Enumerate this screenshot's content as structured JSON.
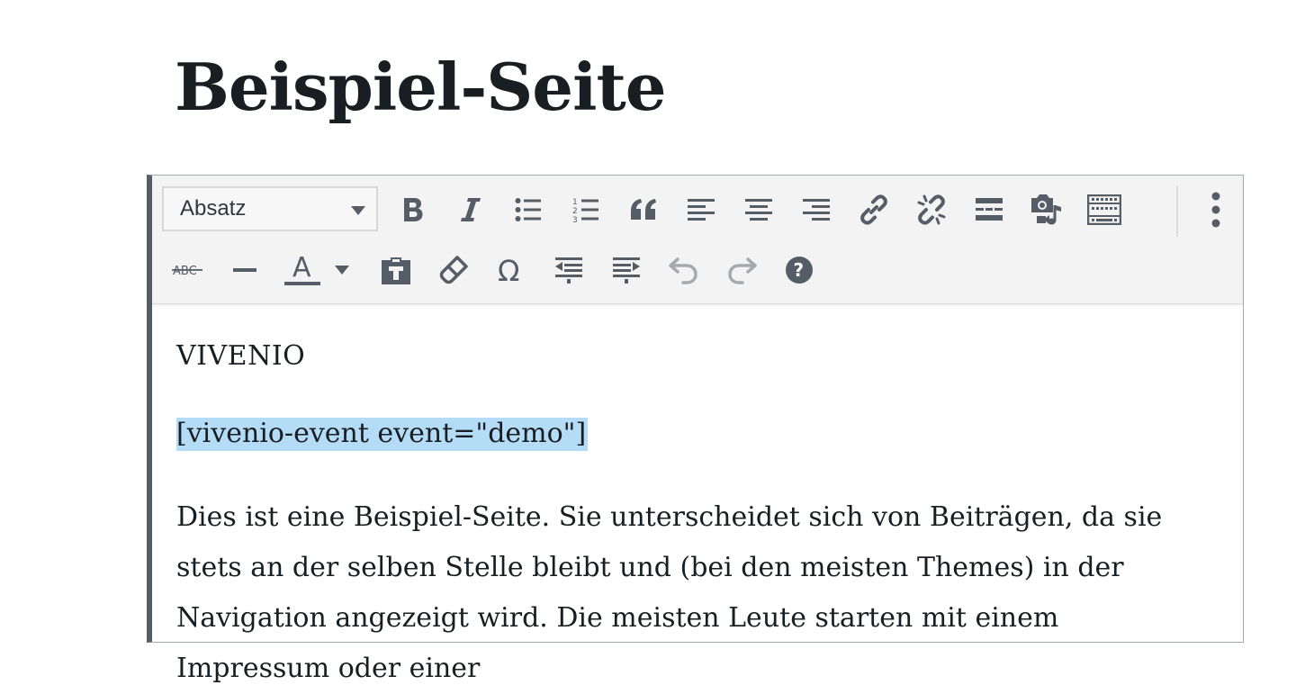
{
  "page": {
    "title": "Beispiel-Seite"
  },
  "toolbar": {
    "format_select": "Absatz",
    "row1_buttons": [
      "bold-icon",
      "italic-icon",
      "bullet-list-icon",
      "numbered-list-icon",
      "blockquote-icon",
      "align-left-icon",
      "align-center-icon",
      "align-right-icon",
      "link-icon",
      "unlink-icon",
      "read-more-icon",
      "add-media-icon",
      "toolbar-toggle-icon",
      "more-options-icon"
    ],
    "row2_buttons": [
      "strikethrough-icon",
      "horizontal-line-icon",
      "text-color-icon",
      "paste-text-icon",
      "clear-formatting-icon",
      "special-character-icon",
      "outdent-icon",
      "indent-icon",
      "undo-icon",
      "redo-icon",
      "help-icon"
    ],
    "strikethrough_text": "ABC",
    "text_color_glyph": "A",
    "special_char_glyph": "Ω",
    "help_glyph": "?",
    "colors": {
      "icon": "#555d66",
      "icon_disabled": "#a7aaad",
      "background": "#f3f3f4"
    }
  },
  "content": {
    "paragraph1": "VIVENIO",
    "paragraph2": "[vivenio-event event=\"demo\"]",
    "paragraph3": "Dies ist eine Beispiel-Seite. Sie unterscheidet sich von Beiträgen, da sie stets an der selben Stelle bleibt und (bei den meisten Themes) in der Navigation angezeigt wird. Die meisten Leute starten mit einem Impressum oder einer",
    "selection_color": "#b4dcf7"
  }
}
